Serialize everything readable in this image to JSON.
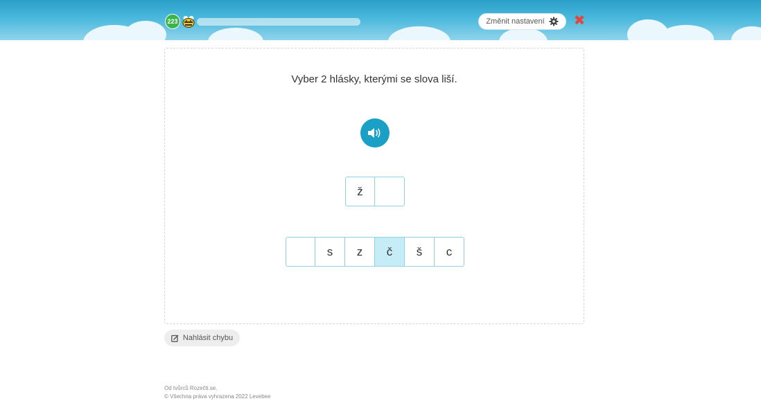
{
  "header": {
    "score": "223",
    "progress": 0,
    "settings_label": "Změnit nastavení",
    "settings_icon": "gear-icon",
    "close_icon": "close-icon",
    "close_glyph": "✖",
    "close_color": "#e2473f"
  },
  "exercise": {
    "instruction": "Vyber 2 hlásky, kterými se slova liší.",
    "audio_icon": "speaker-icon",
    "answer_slots": [
      "ž",
      ""
    ],
    "choices": [
      "",
      "s",
      "z",
      "č",
      "š",
      "c"
    ],
    "selected_choice": "č"
  },
  "report": {
    "label": "Nahlásit chybu",
    "icon": "edit-icon"
  },
  "footer": {
    "line1": "Od tvůrců Rozečti.se.",
    "line2": "© Všechna práva vyhrazena 2022 Levebee"
  },
  "colors": {
    "accent": "#1a9fc6",
    "score_badge": "#39b54a",
    "selected_choice_bg": "#c6ecf8",
    "slot_border": "#8ed2e6"
  }
}
